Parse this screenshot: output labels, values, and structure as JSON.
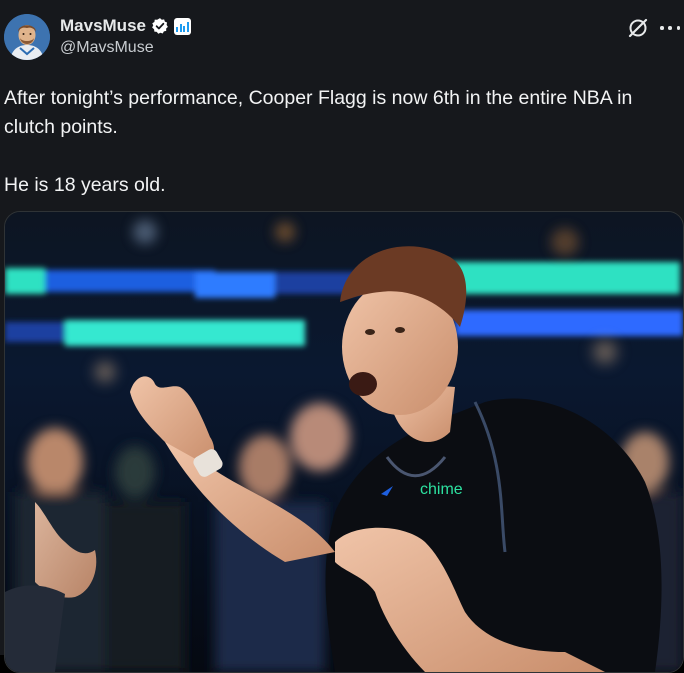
{
  "author": {
    "display_name": "MavsMuse",
    "handle": "@MavsMuse",
    "avatar_icon": "avatar-illustration",
    "verified_icon": "verified-badge-icon",
    "affiliation_icon": "bar-chart-badge-icon"
  },
  "tweet": {
    "line1": "After tonight’s performance, Cooper Flagg is now 6th in the entire NBA in clutch points.",
    "line2": "He is 18 years old."
  },
  "media": {
    "jersey_sponsor": "chime"
  },
  "actions": {
    "grok_icon": "grok-icon",
    "more_icon": "more-options-icon"
  },
  "colors": {
    "background": "#16181c",
    "text": "#e7e9ea",
    "verified": "#ffffff",
    "accent": "#1d9bf0",
    "arena_teal": "#2de1c2",
    "arena_blue": "#1e6fff"
  }
}
